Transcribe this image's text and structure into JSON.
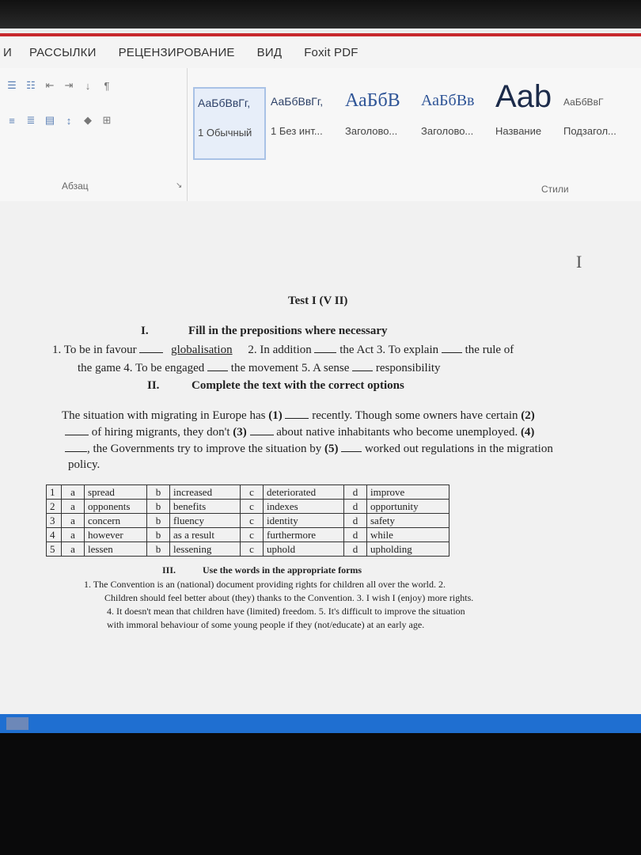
{
  "ribbon": {
    "tabs": [
      "И",
      "РАССЫЛКИ",
      "РЕЦЕНЗИРОВАНИЕ",
      "ВИД",
      "Foxit PDF"
    ],
    "paragraph_group_label": "Абзац",
    "styles_group_label": "Стили",
    "styles": [
      {
        "sample": "АаБбВвГг,",
        "name": "1 Обычный",
        "selected": true
      },
      {
        "sample": "АаБбВвГг,",
        "name": "1 Без инт...",
        "selected": false
      },
      {
        "sample": "АаБбВ",
        "name": "Заголово...",
        "selected": false
      },
      {
        "sample": "АаБбВв",
        "name": "Заголово...",
        "selected": false
      },
      {
        "sample": "Aab",
        "name": "Название",
        "selected": false
      },
      {
        "sample": "АаБбВвГ",
        "name": "Подзагол...",
        "selected": false
      }
    ]
  },
  "document": {
    "title": "Test I (V II)",
    "section1": {
      "num": "I.",
      "heading": "Fill in the prepositions where necessary",
      "line1_a": "1.  To be in favour",
      "line1_b": "globalisation",
      "line1_c": "2. In addition",
      "line1_d": "the Act  3. To explain",
      "line1_e": "the rule of",
      "line2_a": "the game   4. To be engaged",
      "line2_b": "the movement   5. A sense",
      "line2_c": "responsibility"
    },
    "section2": {
      "num": "II.",
      "heading": "Complete the text with the correct options",
      "p1_a": "The situation with migrating in Europe has",
      "p1_n1": "(1)",
      "p1_b": "recently. Though some owners have certain",
      "p1_n2": "(2)",
      "p2_a": "of hiring migrants, they don't",
      "p2_n3": "(3)",
      "p2_b": "about native inhabitants who become unemployed.",
      "p2_n4": "(4)",
      "p3_a": ", the Governments try to improve the situation by",
      "p3_n5": "(5)",
      "p3_b": "worked out regulations in the migration",
      "p4": "policy."
    },
    "options_table": [
      [
        "1",
        "a",
        "spread",
        "b",
        "increased",
        "c",
        "deteriorated",
        "d",
        "improve"
      ],
      [
        "2",
        "a",
        "opponents",
        "b",
        "benefits",
        "c",
        "indexes",
        "d",
        "opportunity"
      ],
      [
        "3",
        "a",
        "concern",
        "b",
        "fluency",
        "c",
        "identity",
        "d",
        "safety"
      ],
      [
        "4",
        "a",
        "however",
        "b",
        "as a result",
        "c",
        "furthermore",
        "d",
        "while"
      ],
      [
        "5",
        "a",
        "lessen",
        "b",
        "lessening",
        "c",
        "uphold",
        "d",
        "upholding"
      ]
    ],
    "section3": {
      "num": "III.",
      "heading": "Use the words in the appropriate forms",
      "line1": "1.   The Convention is an (national) document providing rights for children all over the world. 2.",
      "line2": "Children should feel better about (they) thanks to the Convention. 3. I wish I (enjoy) more rights.",
      "line3": "4. It doesn't mean that children have (limited) freedom. 5. It's difficult to improve the situation",
      "line4": "with immoral behaviour of some young people if they (not/educate) at an early age."
    }
  }
}
